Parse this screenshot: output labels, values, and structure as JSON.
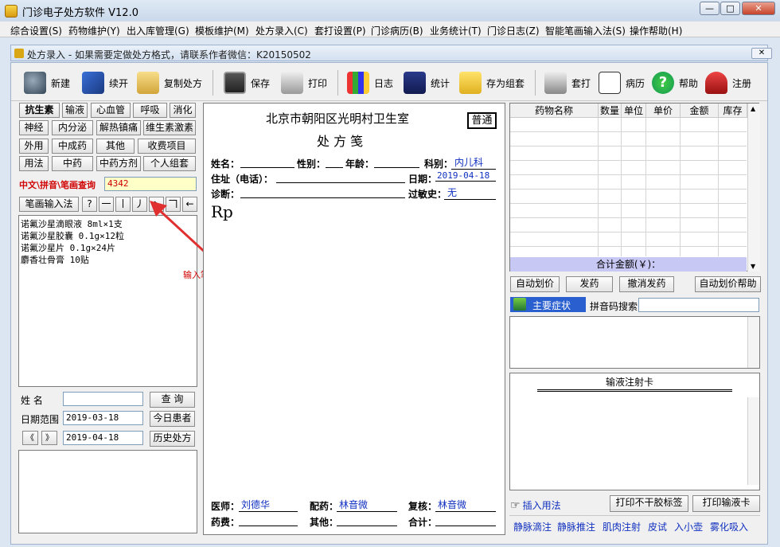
{
  "window": {
    "title": "门诊电子处方软件   V12.0"
  },
  "menu": [
    "综合设置(S)",
    "药物维护(Y)",
    "出入库管理(G)",
    "模板维护(M)",
    "处方录入(C)",
    "套打设置(P)",
    "门诊病历(B)",
    "业务统计(T)",
    "门诊日志(Z)",
    "智能笔画输入法(S)",
    "操作帮助(H)"
  ],
  "child": {
    "title": "处方录入 - 如果需要定做处方格式，请联系作者微信：K20150502",
    "close": "✕"
  },
  "toolbar": {
    "new": "新建",
    "continue": "续开",
    "copy": "复制处方",
    "save": "保存",
    "print": "打印",
    "log": "日志",
    "stats": "统计",
    "save_group": "存为组套",
    "overprint": "套打",
    "record": "病历",
    "help": "帮助",
    "register": "注册"
  },
  "categories": [
    "抗生素",
    "输液",
    "心血管",
    "呼吸",
    "消化",
    "神经",
    "内分泌",
    "解热镇痛",
    "维生素激素",
    "外用",
    "中成药",
    "其他",
    "收费项目",
    "用法",
    "中药",
    "中药方剂",
    "个人组套"
  ],
  "search": {
    "label": "中文\\拼音\\笔画查询",
    "value": "4342"
  },
  "stroke": {
    "button": "笔画输入法",
    "keys": [
      "?",
      "一",
      "丨",
      "丿",
      "丶",
      "𠃍",
      "←"
    ]
  },
  "drug_list": [
    "诺氟沙星滴眼液 8ml×1支",
    "诺氟沙星胶囊 0.1g×12粒",
    "诺氟沙星片 0.1g×24片",
    "麝香壮骨膏 10贴"
  ],
  "annotation": "输入笔画查询",
  "patient_search": {
    "name_label": "姓    名",
    "name_value": "",
    "query": "查  询",
    "date_label": "日期范围",
    "date_from": "2019-03-18",
    "today": "今日患者",
    "prev": "《",
    "next": "》",
    "date_to": "2019-04-18",
    "history": "历史处方"
  },
  "rx": {
    "clinic": "北京市朝阳区光明村卫生室",
    "title": "处  方  笺",
    "type_badge": "普通",
    "name_label": "姓名：",
    "sex_label": "性别：",
    "age_label": "年龄：",
    "dept_label": "科别：",
    "dept_value": "内儿科",
    "addr_label": "住址（电话）：",
    "date_label": "日期：",
    "date_value": "2019-04-18",
    "diag_label": "诊断：",
    "allergy_label": "过敏史：",
    "allergy_value": "无",
    "rp": "Rp",
    "doctor_label": "医师：",
    "doctor_value": "刘德华",
    "dispense_label": "配药：",
    "dispense_value": "林音微",
    "check_label": "复核：",
    "check_value": "林音微",
    "fee_label": "药费：",
    "other_label": "其他：",
    "total_label": "合计："
  },
  "grid": {
    "columns": [
      "药物名称",
      "数量",
      "单位",
      "单价",
      "金额",
      "库存"
    ],
    "total": "合计金额(￥)："
  },
  "actions": {
    "auto_price": "自动划价",
    "dispense": "发药",
    "cancel": "撤消发药",
    "auto_help": "自动划价帮助"
  },
  "symptom": {
    "label": "主要症状",
    "pinyin": "拼音码搜索"
  },
  "infusion": {
    "title": "输液注射卡"
  },
  "bottom": {
    "insert": "插入用法",
    "print_label": "打印不干胶标签",
    "print_card": "打印输液卡"
  },
  "usages": [
    "静脉滴注",
    "静脉推注",
    "肌肉注射",
    "皮试",
    "入小壶",
    "雾化吸入"
  ],
  "colors": {
    "accent_blue": "#1030c0",
    "total_row": "#c8c8f5",
    "symptom_bar": "#2a5fd0"
  }
}
